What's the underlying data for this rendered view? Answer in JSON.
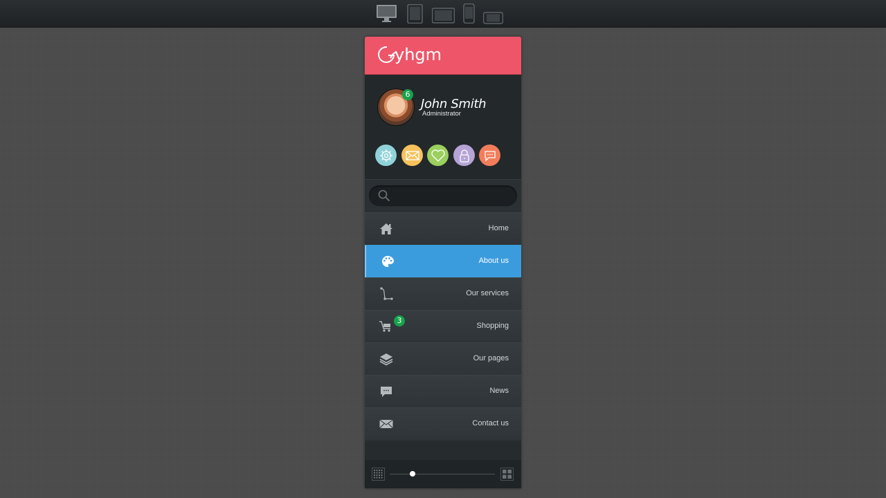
{
  "toolbar": {
    "devices": [
      {
        "name": "desktop",
        "active": true
      },
      {
        "name": "tablet-portrait",
        "active": false
      },
      {
        "name": "tablet-landscape",
        "active": false
      },
      {
        "name": "phone-portrait",
        "active": false
      },
      {
        "name": "phone-landscape",
        "active": false
      }
    ]
  },
  "brand": {
    "logo_text": "yhgm",
    "color": "#ee5569"
  },
  "profile": {
    "name": "John Smith",
    "role": "Administrator",
    "notification_count": "6"
  },
  "quick_actions": [
    {
      "icon": "gear-icon",
      "color": "#8fd3d8"
    },
    {
      "icon": "mail-icon",
      "color": "#f7c25c"
    },
    {
      "icon": "heart-icon",
      "color": "#9bcf5e"
    },
    {
      "icon": "lock-icon",
      "color": "#b6a4d6"
    },
    {
      "icon": "chat-icon",
      "color": "#f37d5a"
    }
  ],
  "search": {
    "placeholder": "",
    "value": ""
  },
  "menu": {
    "items": [
      {
        "label": "Home",
        "icon": "home-icon"
      },
      {
        "label": "About us",
        "icon": "palette-icon",
        "active": true
      },
      {
        "label": "Our services",
        "icon": "vector-path-icon"
      },
      {
        "label": "Shopping",
        "icon": "cart-icon",
        "badge": "3"
      },
      {
        "label": "Our pages",
        "icon": "layers-icon"
      },
      {
        "label": "News",
        "icon": "speech-bubble-icon"
      },
      {
        "label": "Contact us",
        "icon": "envelope-icon"
      }
    ]
  },
  "footer": {
    "slider_value": 0.22
  },
  "colors": {
    "accent": "#3b9cdd",
    "badge": "#17a24b"
  }
}
